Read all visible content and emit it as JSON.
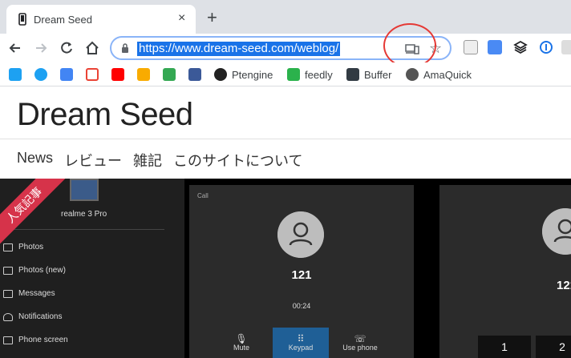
{
  "browser": {
    "tab_title": "Dream Seed",
    "close_symbol": "×",
    "newtab_symbol": "+",
    "url": "https://www.dream-seed.com/weblog/",
    "star_symbol": "☆"
  },
  "bookmarks": [
    {
      "label": "Ptengine"
    },
    {
      "label": "feedly"
    },
    {
      "label": "Buffer"
    },
    {
      "label": "AmaQuick"
    }
  ],
  "site": {
    "title": "Dream Seed",
    "nav": [
      "News",
      "レビュー",
      "雑記",
      "このサイトについて"
    ]
  },
  "hero": {
    "ribbon": "人気記事",
    "device_name": "realme 3 Pro",
    "menu": [
      "Photos",
      "Photos (new)",
      "Messages",
      "Notifications",
      "Phone screen"
    ],
    "call_label": "Call",
    "call_number": "121",
    "call_time": "00:24",
    "controls": [
      "Mute",
      "Keypad",
      "Use phone"
    ],
    "right_number": "121",
    "keys": [
      "1",
      "2"
    ]
  },
  "colors": {
    "accent": "#1a73e8",
    "ribbon": "#d6334a",
    "highlight_circle": "#e53935"
  }
}
